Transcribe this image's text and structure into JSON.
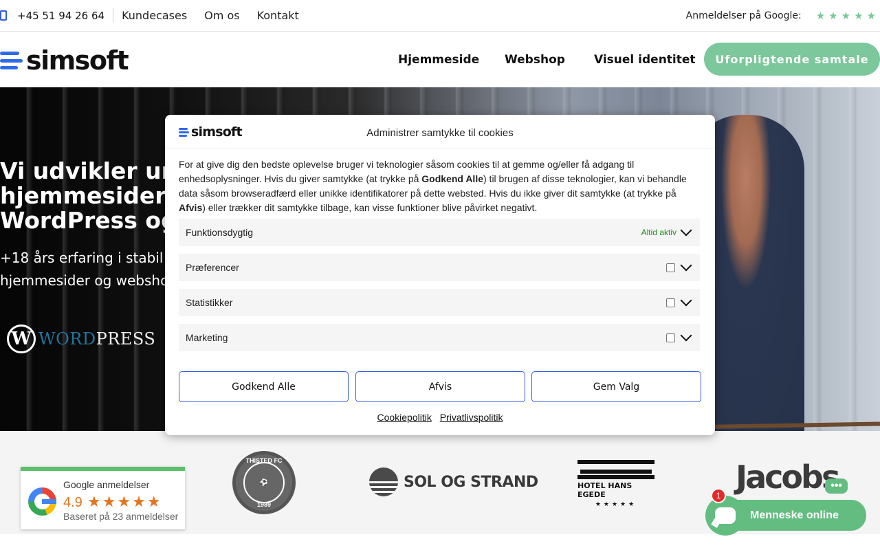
{
  "topbar": {
    "phone": "+45 51 94 26 64",
    "links": [
      "Kundecases",
      "Om os",
      "Kontakt"
    ],
    "reviews_label": "Anmeldelser på Google:",
    "star_count": 5,
    "star_color": "#7bc99a"
  },
  "header": {
    "logo_text": "simsoft",
    "nav": [
      "Hjemmeside",
      "Webshop",
      "Visuel identitet"
    ],
    "cta": "Uforpligtende samtale",
    "accent_color": "#7cc79b",
    "brand_blue": "#2f6be8"
  },
  "hero": {
    "title_lines": [
      "Vi udvikler un",
      "hjemmesider o",
      "WordPress og"
    ],
    "subtitle_lines": [
      "+18 års erfaring i stabil o",
      "hjemmesider og websho"
    ],
    "wordpress_logo": {
      "part1": "WORD",
      "part2": "PRESS"
    }
  },
  "cookie": {
    "logo_text": "simsoft",
    "title": "Administrer samtykke til cookies",
    "body_parts": [
      "For at give dig den bedste oplevelse bruger vi teknologier såsom cookies til at gemme og/eller få adgang til enhedsoplysninger. Hvis du giver samtykke (at trykke på ",
      "Godkend Alle",
      ") til brugen af disse teknologier, kan vi behandle data såsom browseradfærd eller unikke identifikatorer på dette websted. Hvis du ikke giver dit samtykke (at trykke på ",
      "Afvis",
      ")  eller trækker dit samtykke tilbage, kan visse funktioner blive påvirket negativt."
    ],
    "categories": [
      {
        "label": "Funktionsdygtig",
        "status": "Altid aktiv"
      },
      {
        "label": "Præferencer",
        "checked": false
      },
      {
        "label": "Statistikker",
        "checked": false
      },
      {
        "label": "Marketing",
        "checked": false
      }
    ],
    "buttons": [
      "Godkend Alle",
      "Afvis",
      "Gem Valg"
    ],
    "links": [
      "Cookiepolitik",
      "Privatlivspolitik"
    ]
  },
  "google_review": {
    "title": "Google anmeldelser",
    "score": "4.9",
    "stars": 5,
    "based_on": "Baseret på 23 anmeldelser"
  },
  "client_logos": {
    "thisted": {
      "name": "THISTED FC",
      "year": "1989"
    },
    "sol": "SOL OG STRAND",
    "hotel": {
      "name": "HOTEL HANS EGEDE",
      "stars": "★★★★★"
    },
    "jacobs": "Jacobs"
  },
  "chat": {
    "label": "Menneske online",
    "badge": "1",
    "dots": "•••"
  }
}
